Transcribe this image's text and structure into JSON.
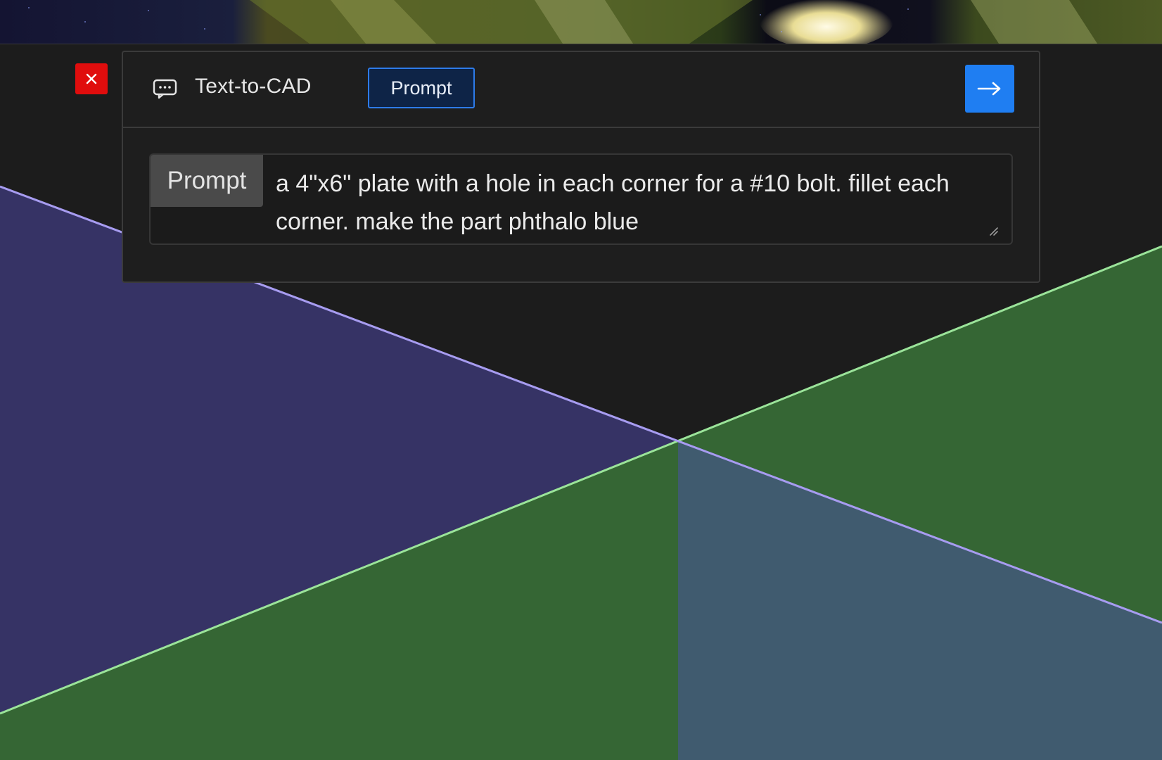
{
  "colors": {
    "background": "#1c1c1c",
    "plane_purple": "#363365",
    "plane_green": "#356634",
    "plane_steel": "#405b6f",
    "line_green": "#9be49a",
    "line_purple": "#a79cf0",
    "close_red": "#e00d0d",
    "accent_blue": "#1f7ef2"
  },
  "close_button": {
    "icon": "close-icon"
  },
  "panel": {
    "icon": "chat-bubble-icon",
    "title": "Text-to-CAD",
    "mode_badge": "Prompt",
    "submit_icon": "arrow-right-icon"
  },
  "prompt": {
    "label": "Prompt",
    "value": "a 4\"x6\" plate with a hole in each corner for a #10 bolt. fillet each corner. make the part phthalo blue"
  }
}
